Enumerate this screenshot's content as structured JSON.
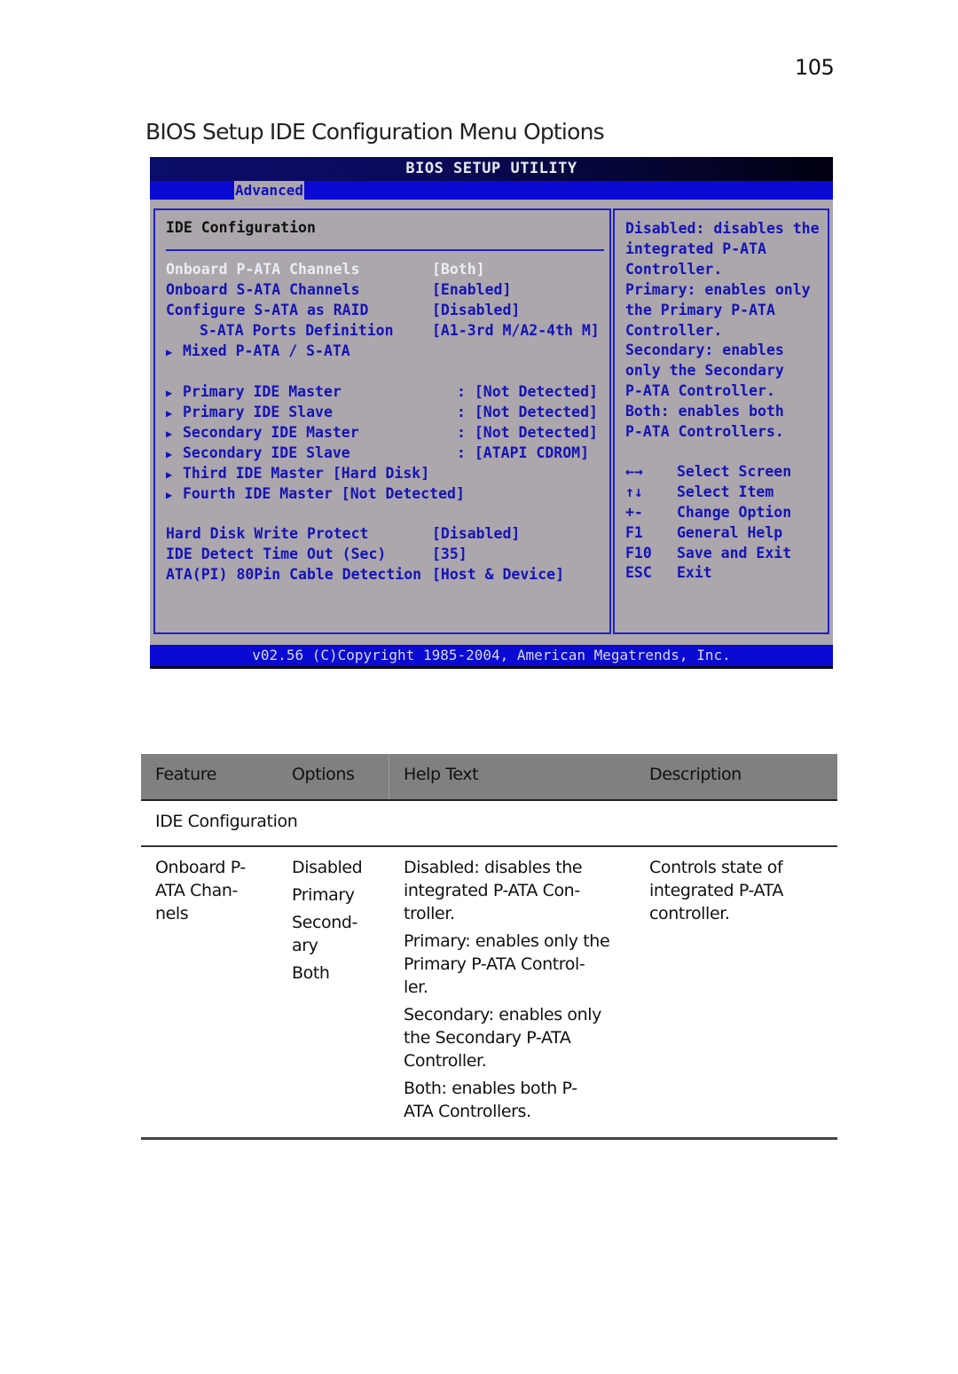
{
  "page": {
    "number": "105",
    "title": "BIOS Setup IDE Configuration Menu Options"
  },
  "bios": {
    "title": "BIOS SETUP UTILITY",
    "active_tab": "Advanced",
    "panel_heading": "IDE Configuration",
    "items": [
      {
        "label": "Onboard P-ATA Channels",
        "value": "[Both]",
        "selected": true,
        "submenu": false
      },
      {
        "label": "Onboard S-ATA Channels",
        "value": "[Enabled]",
        "selected": false,
        "submenu": false
      },
      {
        "label": "Configure S-ATA as RAID",
        "value": "[Disabled]",
        "selected": false,
        "submenu": false
      },
      {
        "label": "S-ATA Ports Definition",
        "value": "[A1-3rd M/A2-4th M]",
        "selected": false,
        "submenu": false
      },
      {
        "label": "Mixed P-ATA / S-ATA",
        "value": "",
        "selected": false,
        "submenu": true
      },
      {
        "label": "Primary IDE Master",
        "value": ": [Not Detected]",
        "selected": false,
        "submenu": true
      },
      {
        "label": "Primary IDE Slave",
        "value": ": [Not Detected]",
        "selected": false,
        "submenu": true
      },
      {
        "label": "Secondary IDE Master",
        "value": ": [Not Detected]",
        "selected": false,
        "submenu": true
      },
      {
        "label": "Secondary IDE Slave",
        "value": ": [ATAPI CDROM]",
        "selected": false,
        "submenu": true
      },
      {
        "label": "Third IDE Master [Hard Disk]",
        "value": "",
        "selected": false,
        "submenu": true
      },
      {
        "label": "Fourth IDE Master [Not Detected]",
        "value": "",
        "selected": false,
        "submenu": true
      },
      {
        "label": "Hard Disk Write Protect",
        "value": "[Disabled]",
        "selected": false,
        "submenu": false
      },
      {
        "label": "IDE Detect Time Out (Sec)",
        "value": "[35]",
        "selected": false,
        "submenu": false
      },
      {
        "label": "ATA(PI) 80Pin Cable Detection",
        "value": "[Host & Device]",
        "selected": false,
        "submenu": false
      }
    ],
    "help_lines": [
      "Disabled: disables the",
      "integrated P-ATA",
      "Controller.",
      "Primary: enables only",
      "the Primary P-ATA",
      "Controller.",
      "Secondary: enables",
      "only the Secondary",
      "P-ATA Controller.",
      "Both: enables both",
      "P-ATA Controllers."
    ],
    "key_legend": [
      {
        "key": "←→",
        "action": "Select Screen"
      },
      {
        "key": "↑↓",
        "action": "Select Item"
      },
      {
        "key": "+-",
        "action": "Change Option"
      },
      {
        "key": "F1",
        "action": "General Help"
      },
      {
        "key": "F10",
        "action": "Save and Exit"
      },
      {
        "key": "ESC",
        "action": "Exit"
      }
    ],
    "footer": "v02.56 (C)Copyright 1985-2004, American Megatrends, Inc.",
    "colors": {
      "background": "#aca6ad",
      "accent_blue": "#0a0ad2",
      "text_blue": "#1414b4",
      "selected_text": "#ececf4"
    }
  },
  "table": {
    "headers": [
      "Feature",
      "Options",
      "Help Text",
      "Description"
    ],
    "section": "IDE Configuration",
    "rows": [
      {
        "feature_lines": [
          "Onboard P-",
          "ATA Chan-",
          "nels"
        ],
        "options": [
          [
            "Disabled"
          ],
          [
            "Primary"
          ],
          [
            "Second-",
            "ary"
          ],
          [
            "Both"
          ]
        ],
        "help": [
          [
            "Disabled: disables the",
            "integrated P-ATA Con-",
            "troller."
          ],
          [
            "Primary: enables only the",
            "Primary P-ATA Control-",
            "ler."
          ],
          [
            "Secondary: enables only",
            "the Secondary P-ATA",
            "Controller."
          ],
          [
            "Both: enables both P-",
            "ATA Controllers."
          ]
        ],
        "description_lines": [
          "Controls state of",
          "integrated P-ATA",
          "controller."
        ]
      }
    ]
  }
}
